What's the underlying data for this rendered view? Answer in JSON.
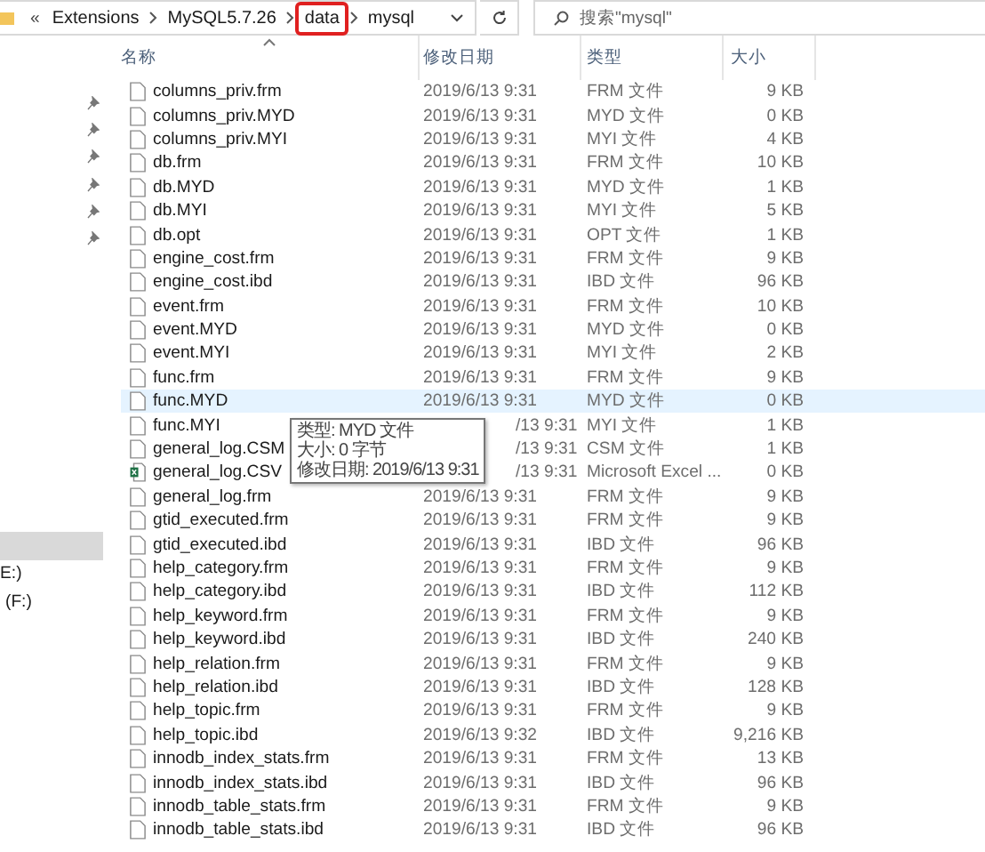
{
  "address_bar": {
    "overflow": "«",
    "crumbs": [
      {
        "label": "Extensions",
        "highlighted": false
      },
      {
        "label": "MySQL5.7.26",
        "highlighted": false
      },
      {
        "label": "data",
        "highlighted": true
      },
      {
        "label": "mysql",
        "highlighted": false
      }
    ]
  },
  "search": {
    "placeholder": "搜索\"mysql\""
  },
  "sidebar": {
    "items": [
      {
        "kind": "pinned",
        "selected": false
      },
      {
        "kind": "pinned",
        "selected": false
      },
      {
        "kind": "pinned",
        "selected": false
      },
      {
        "kind": "pinned",
        "selected": false
      },
      {
        "kind": "pinned",
        "selected": false
      },
      {
        "kind": "pinned",
        "selected": false
      },
      {
        "kind": "blank",
        "selected": true
      },
      {
        "kind": "drive",
        "label": "E:)",
        "selected": false
      },
      {
        "kind": "drive",
        "label": "(F:)",
        "selected": false
      }
    ]
  },
  "table": {
    "columns": [
      "名称",
      "修改日期",
      "类型",
      "大小"
    ],
    "rows": [
      {
        "name": "columns_priv.frm",
        "date": "2019/6/13 9:31",
        "type": "FRM 文件",
        "size": "9 KB",
        "kind": "file",
        "selected": false
      },
      {
        "name": "columns_priv.MYD",
        "date": "2019/6/13 9:31",
        "type": "MYD 文件",
        "size": "0 KB",
        "kind": "file",
        "selected": false
      },
      {
        "name": "columns_priv.MYI",
        "date": "2019/6/13 9:31",
        "type": "MYI 文件",
        "size": "4 KB",
        "kind": "file",
        "selected": false
      },
      {
        "name": "db.frm",
        "date": "2019/6/13 9:31",
        "type": "FRM 文件",
        "size": "10 KB",
        "kind": "file",
        "selected": false
      },
      {
        "name": "db.MYD",
        "date": "2019/6/13 9:31",
        "type": "MYD 文件",
        "size": "1 KB",
        "kind": "file",
        "selected": false
      },
      {
        "name": "db.MYI",
        "date": "2019/6/13 9:31",
        "type": "MYI 文件",
        "size": "5 KB",
        "kind": "file",
        "selected": false
      },
      {
        "name": "db.opt",
        "date": "2019/6/13 9:31",
        "type": "OPT 文件",
        "size": "1 KB",
        "kind": "file",
        "selected": false
      },
      {
        "name": "engine_cost.frm",
        "date": "2019/6/13 9:31",
        "type": "FRM 文件",
        "size": "9 KB",
        "kind": "file",
        "selected": false
      },
      {
        "name": "engine_cost.ibd",
        "date": "2019/6/13 9:31",
        "type": "IBD 文件",
        "size": "96 KB",
        "kind": "file",
        "selected": false
      },
      {
        "name": "event.frm",
        "date": "2019/6/13 9:31",
        "type": "FRM 文件",
        "size": "10 KB",
        "kind": "file",
        "selected": false
      },
      {
        "name": "event.MYD",
        "date": "2019/6/13 9:31",
        "type": "MYD 文件",
        "size": "0 KB",
        "kind": "file",
        "selected": false
      },
      {
        "name": "event.MYI",
        "date": "2019/6/13 9:31",
        "type": "MYI 文件",
        "size": "2 KB",
        "kind": "file",
        "selected": false
      },
      {
        "name": "func.frm",
        "date": "2019/6/13 9:31",
        "type": "FRM 文件",
        "size": "9 KB",
        "kind": "file",
        "selected": false
      },
      {
        "name": "func.MYD",
        "date": "2019/6/13 9:31",
        "type": "MYD 文件",
        "size": "0 KB",
        "kind": "file",
        "selected": true
      },
      {
        "name": "func.MYI",
        "date": "/13 9:31",
        "date_covered": true,
        "type": "MYI 文件",
        "size": "1 KB",
        "kind": "file",
        "selected": false
      },
      {
        "name": "general_log.CSM",
        "date": "/13 9:31",
        "date_covered": true,
        "type": "CSM 文件",
        "size": "1 KB",
        "kind": "file",
        "selected": false
      },
      {
        "name": "general_log.CSV",
        "date": "/13 9:31",
        "date_covered": true,
        "type": "Microsoft Excel ...",
        "size": "0 KB",
        "kind": "excel",
        "selected": false
      },
      {
        "name": "general_log.frm",
        "date": "2019/6/13 9:31",
        "type": "FRM 文件",
        "size": "9 KB",
        "kind": "file",
        "selected": false
      },
      {
        "name": "gtid_executed.frm",
        "date": "2019/6/13 9:31",
        "type": "FRM 文件",
        "size": "9 KB",
        "kind": "file",
        "selected": false
      },
      {
        "name": "gtid_executed.ibd",
        "date": "2019/6/13 9:31",
        "type": "IBD 文件",
        "size": "96 KB",
        "kind": "file",
        "selected": false
      },
      {
        "name": "help_category.frm",
        "date": "2019/6/13 9:31",
        "type": "FRM 文件",
        "size": "9 KB",
        "kind": "file",
        "selected": false
      },
      {
        "name": "help_category.ibd",
        "date": "2019/6/13 9:31",
        "type": "IBD 文件",
        "size": "112 KB",
        "kind": "file",
        "selected": false
      },
      {
        "name": "help_keyword.frm",
        "date": "2019/6/13 9:31",
        "type": "FRM 文件",
        "size": "9 KB",
        "kind": "file",
        "selected": false
      },
      {
        "name": "help_keyword.ibd",
        "date": "2019/6/13 9:31",
        "type": "IBD 文件",
        "size": "240 KB",
        "kind": "file",
        "selected": false
      },
      {
        "name": "help_relation.frm",
        "date": "2019/6/13 9:31",
        "type": "FRM 文件",
        "size": "9 KB",
        "kind": "file",
        "selected": false
      },
      {
        "name": "help_relation.ibd",
        "date": "2019/6/13 9:31",
        "type": "IBD 文件",
        "size": "128 KB",
        "kind": "file",
        "selected": false
      },
      {
        "name": "help_topic.frm",
        "date": "2019/6/13 9:31",
        "type": "FRM 文件",
        "size": "9 KB",
        "kind": "file",
        "selected": false
      },
      {
        "name": "help_topic.ibd",
        "date": "2019/6/13 9:32",
        "type": "IBD 文件",
        "size": "9,216 KB",
        "kind": "file",
        "selected": false
      },
      {
        "name": "innodb_index_stats.frm",
        "date": "2019/6/13 9:31",
        "type": "FRM 文件",
        "size": "13 KB",
        "kind": "file",
        "selected": false
      },
      {
        "name": "innodb_index_stats.ibd",
        "date": "2019/6/13 9:31",
        "type": "IBD 文件",
        "size": "96 KB",
        "kind": "file",
        "selected": false
      },
      {
        "name": "innodb_table_stats.frm",
        "date": "2019/6/13 9:31",
        "type": "FRM 文件",
        "size": "9 KB",
        "kind": "file",
        "selected": false
      },
      {
        "name": "innodb_table_stats.ibd",
        "date": "2019/6/13 9:31",
        "type": "IBD 文件",
        "size": "96 KB",
        "kind": "file",
        "selected": false
      }
    ]
  },
  "tooltip": {
    "lines": [
      "类型: MYD 文件",
      "大小: 0 字节",
      "修改日期: 2019/6/13 9:31"
    ]
  }
}
